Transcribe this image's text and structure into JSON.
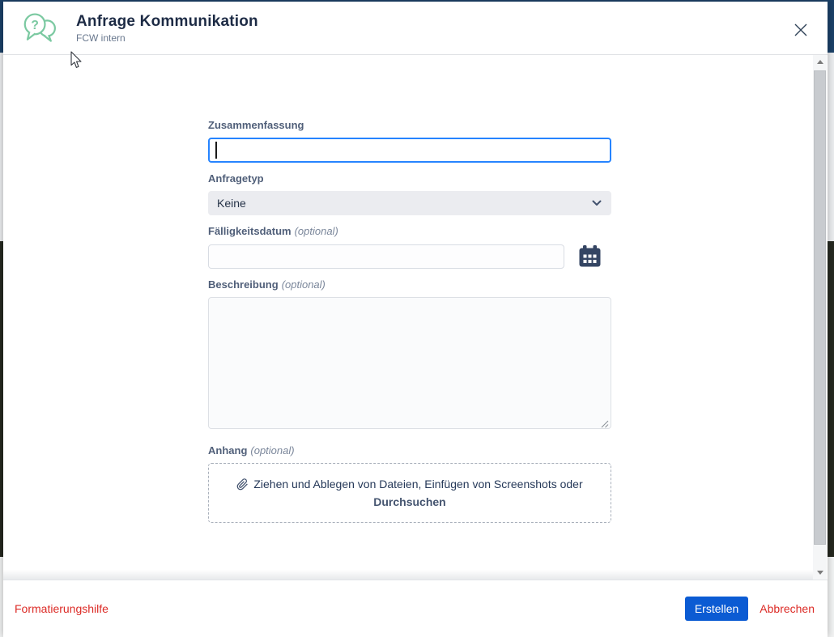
{
  "dialog": {
    "title": "Anfrage Kommunikation",
    "subtitle": "FCW intern"
  },
  "form": {
    "summary_label": "Zusammenfassung",
    "summary_value": "",
    "request_type_label": "Anfragetyp",
    "request_type_value": "Keine",
    "due_date_label": "Fälligkeitsdatum",
    "due_date_value": "",
    "description_label": "Beschreibung",
    "description_value": "",
    "attachment_label": "Anhang",
    "optional_suffix": "(optional)",
    "dropzone_text": "Ziehen und Ablegen von Dateien, Einfügen von Screenshots oder",
    "browse_label": "Durchsuchen"
  },
  "footer": {
    "formatting_help": "Formatierungshilfe",
    "create": "Erstellen",
    "cancel": "Abbrechen"
  },
  "colors": {
    "primary_button_blue": "#0B5BD3",
    "focus_border_blue": "#2684FF",
    "link_red": "#DC2B26",
    "help_icon_green": "#7BC9A1",
    "page_header_navy": "#1B4168",
    "calendar_icon_navy": "#344563"
  }
}
